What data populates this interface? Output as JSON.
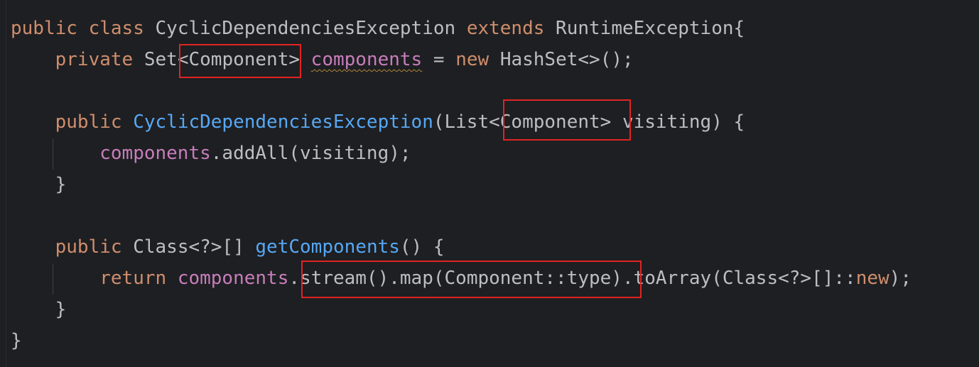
{
  "code": {
    "line1": {
      "kw_public": "public",
      "kw_class": "class",
      "class_name": "CyclicDependenciesException",
      "kw_extends": "extends",
      "super_class": "RuntimeException{"
    },
    "line2": {
      "kw_private": "private",
      "type_prefix": "Set",
      "generic": "<Component>",
      "field": "components",
      "assign": " = ",
      "kw_new": "new",
      "rest": "HashSet<>();"
    },
    "line4": {
      "kw_public": "public",
      "ctor_name": "CyclicDependenciesException",
      "param_open": "(List",
      "generic": "<Component>",
      "param_rest": " visiting) {"
    },
    "line5": {
      "field": "components",
      "call": ".addAll(visiting);"
    },
    "line6": {
      "brace": "}"
    },
    "line8": {
      "kw_public": "public",
      "ret_type": "Class<?>[]",
      "method_name": "getComponents",
      "rest": "() {"
    },
    "line9": {
      "kw_return": "return",
      "field": "components",
      "dot": ".",
      "stream_chain": "stream().map(Component::type)",
      "to_array": ".toArray(Class<?>[]::",
      "kw_new": "new",
      "end": ");"
    },
    "line10": {
      "brace": "}"
    },
    "line11": {
      "brace": "}"
    }
  },
  "colors": {
    "background": "#1e1f22",
    "keyword": "#cf8e6d",
    "field": "#c77dbb",
    "method_declaration": "#56a8f5",
    "default_text": "#bcbec4",
    "highlight_box": "#e12323"
  }
}
